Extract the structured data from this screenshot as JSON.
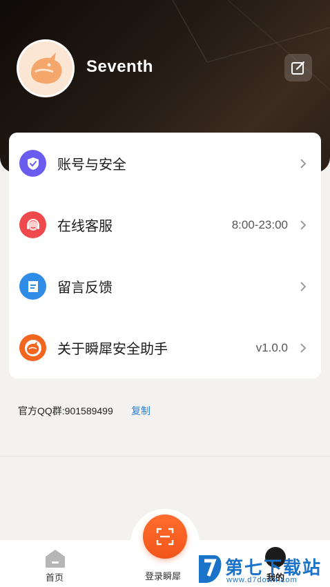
{
  "profile": {
    "username": "Seventh"
  },
  "menu": {
    "items": [
      {
        "label": "账号与安全",
        "value": "",
        "icon": "shield-check-icon",
        "color": "#6b5cf0"
      },
      {
        "label": "在线客服",
        "value": "8:00-23:00",
        "icon": "headset-icon",
        "color": "#f0494d"
      },
      {
        "label": "留言反馈",
        "value": "",
        "icon": "message-icon",
        "color": "#2f8de8"
      },
      {
        "label": "关于瞬犀安全助手",
        "value": "v1.0.0",
        "icon": "rhino-logo-icon",
        "color": "#f2661f"
      }
    ]
  },
  "qq": {
    "text": "官方QQ群:901589499",
    "copy_label": "复制"
  },
  "tabbar": {
    "home_label": "首页",
    "scan_label": "登录瞬犀",
    "mine_label": "我的"
  },
  "watermark": {
    "title": "第七下载站",
    "url": "www.d7down.com"
  },
  "colors": {
    "accent": "#f2551b",
    "link": "#2f7fd6"
  }
}
